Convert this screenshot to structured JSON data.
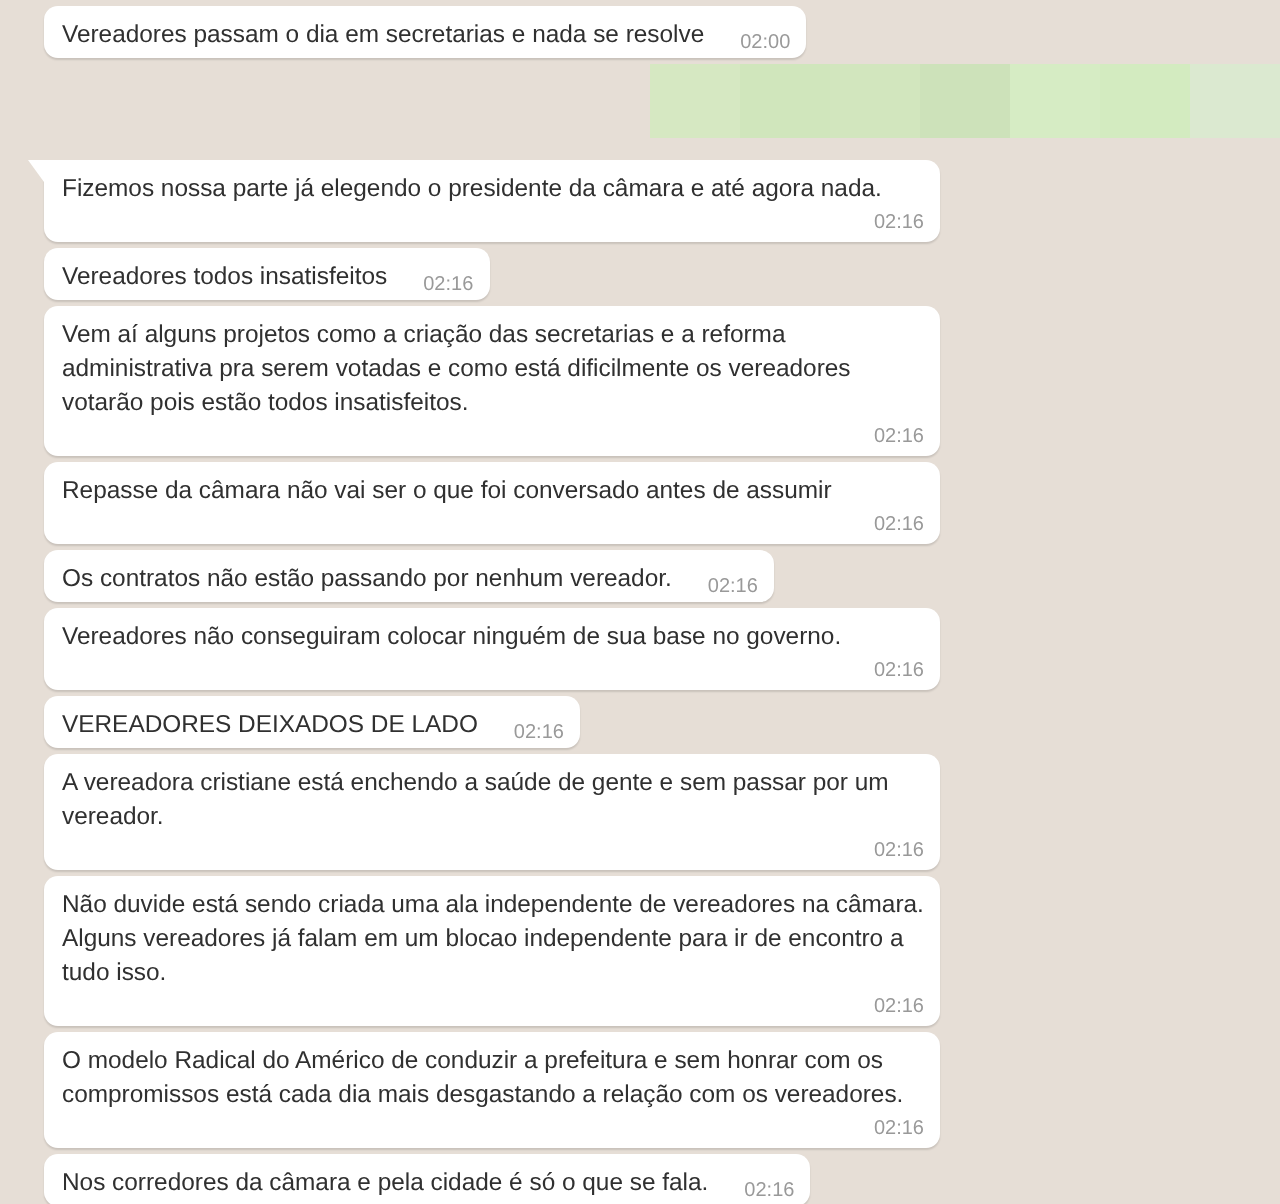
{
  "messages": [
    {
      "kind": "inline",
      "tail": false,
      "text": "Vereadores passam o dia em secretarias e nada se resolve",
      "time": "02:00"
    },
    {
      "kind": "redacted"
    },
    {
      "kind": "stacked",
      "tail": true,
      "text": "Fizemos nossa parte já elegendo o presidente da câmara e até agora nada.",
      "time": "02:16"
    },
    {
      "kind": "inline",
      "tail": false,
      "text": "Vereadores todos insatisfeitos",
      "time": "02:16"
    },
    {
      "kind": "stacked",
      "tail": false,
      "text": "Vem aí alguns projetos como a criação das secretarias e a reforma administrativa pra serem votadas e como está dificilmente os vereadores votarão pois estão todos insatisfeitos.",
      "time": "02:16"
    },
    {
      "kind": "stacked",
      "tail": false,
      "text": "Repasse da câmara não vai ser o que foi conversado antes de assumir",
      "time": "02:16"
    },
    {
      "kind": "inline",
      "tail": false,
      "text": "Os contratos não estão passando por nenhum vereador.",
      "time": "02:16"
    },
    {
      "kind": "stacked",
      "tail": false,
      "text": "Vereadores não conseguiram colocar ninguém de sua base no governo.",
      "time": "02:16"
    },
    {
      "kind": "inline",
      "tail": false,
      "text": "VEREADORES DEIXADOS DE LADO",
      "time": "02:16"
    },
    {
      "kind": "stacked",
      "tail": false,
      "text": "A vereadora cristiane está enchendo a saúde de gente e sem passar por um vereador.",
      "time": "02:16"
    },
    {
      "kind": "stacked",
      "tail": false,
      "text": "Não duvide está sendo criada uma ala independente de vereadores na câmara. Alguns vereadores já falam em um blocao independente para ir de encontro a tudo isso.",
      "time": "02:16"
    },
    {
      "kind": "stacked",
      "tail": false,
      "text": "O modelo Radical do Américo de conduzir a prefeitura e sem honrar com os compromissos está cada dia mais desgastando a relação com os vereadores.",
      "time": "02:16"
    },
    {
      "kind": "inline",
      "tail": false,
      "text": "Nos corredores da câmara e pela cidade é só o que se fala.",
      "time": "02:16"
    }
  ]
}
